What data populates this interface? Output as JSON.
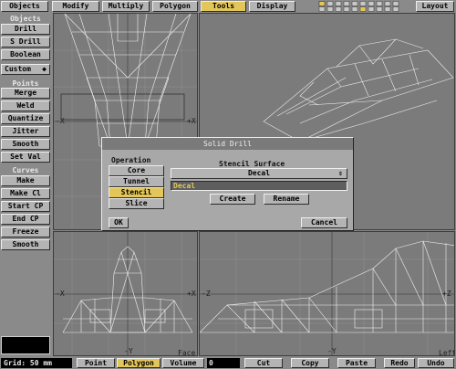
{
  "top_menu": {
    "items": [
      "Objects",
      "Modify",
      "Multiply",
      "Polygon",
      "Tools",
      "Display"
    ],
    "active": "Tools",
    "layout_label": "Layout"
  },
  "toolbar": {
    "section_objects": "Objects",
    "objects": [
      "Drill",
      "S Drill",
      "Boolean",
      "Custom"
    ],
    "section_points": "Points",
    "points": [
      "Merge",
      "Weld",
      "Quantize",
      "Jitter",
      "Smooth",
      "Set Val"
    ],
    "section_curves": "Curves",
    "curves": [
      "Make",
      "Make Cl",
      "Start CP",
      "End CP",
      "Freeze",
      "Smooth"
    ]
  },
  "viewports": {
    "top_left": {
      "axis_neg": "-X",
      "axis_pos": "+X"
    },
    "bottom_left": {
      "axis_x_neg": "-X",
      "axis_x_pos": "+X",
      "axis_y": "-Y",
      "label": "Face"
    },
    "bottom_right": {
      "axis_z_neg": "-Z",
      "axis_z_pos": "+Z",
      "axis_y": "-Y",
      "label": "Left"
    }
  },
  "dialog": {
    "title": "Solid Drill",
    "operation_label": "Operation",
    "operations": [
      "Core",
      "Tunnel",
      "Stencil",
      "Slice"
    ],
    "selected_operation": "Stencil",
    "stencil_surface_label": "Stencil Surface",
    "surface_select": "Decal",
    "surface_input": "Decal",
    "create_label": "Create",
    "rename_label": "Rename",
    "ok_label": "OK",
    "cancel_label": "Cancel"
  },
  "status_bar": {
    "grid": "Grid: 50 mm",
    "modes": [
      "Point",
      "Polygon",
      "Volume"
    ],
    "active_mode": "Polygon",
    "count": "0",
    "actions": [
      "Cut",
      "Copy",
      "Paste",
      "Redo",
      "Undo"
    ]
  },
  "colors": {
    "active": "#e3c65a",
    "input_text": "#e3c65a",
    "panel": "#b4b4b4"
  }
}
